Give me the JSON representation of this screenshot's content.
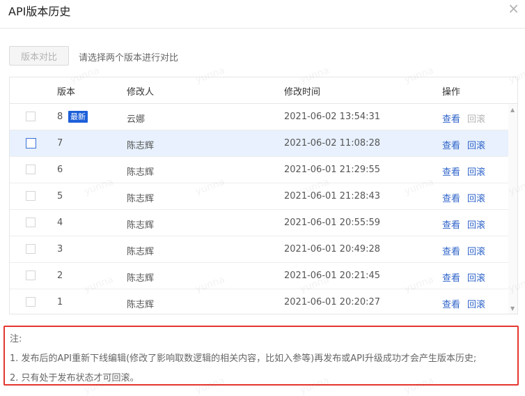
{
  "dialog": {
    "title": "API版本历史",
    "close_glyph": "×"
  },
  "toolbar": {
    "compare_label": "版本对比",
    "hint": "请选择两个版本进行对比"
  },
  "table": {
    "columns": [
      "版本",
      "修改人",
      "修改时间",
      "操作"
    ],
    "latest_badge": "最新",
    "view_label": "查看",
    "rollback_label": "回滚",
    "rows": [
      {
        "version": "8",
        "editor": "云娜",
        "time": "2021-06-02 13:54:31",
        "latest": true,
        "selected": false,
        "rollback_enabled": false
      },
      {
        "version": "7",
        "editor": "陈志辉",
        "time": "2021-06-02 11:08:28",
        "latest": false,
        "selected": true,
        "rollback_enabled": true
      },
      {
        "version": "6",
        "editor": "陈志辉",
        "time": "2021-06-01 21:29:55",
        "latest": false,
        "selected": false,
        "rollback_enabled": true
      },
      {
        "version": "5",
        "editor": "陈志辉",
        "time": "2021-06-01 21:28:43",
        "latest": false,
        "selected": false,
        "rollback_enabled": true
      },
      {
        "version": "4",
        "editor": "陈志辉",
        "time": "2021-06-01 20:55:59",
        "latest": false,
        "selected": false,
        "rollback_enabled": true
      },
      {
        "version": "3",
        "editor": "陈志辉",
        "time": "2021-06-01 20:49:28",
        "latest": false,
        "selected": false,
        "rollback_enabled": true
      },
      {
        "version": "2",
        "editor": "陈志辉",
        "time": "2021-06-01 20:21:45",
        "latest": false,
        "selected": false,
        "rollback_enabled": true
      },
      {
        "version": "1",
        "editor": "陈志辉",
        "time": "2021-06-01 20:20:27",
        "latest": false,
        "selected": false,
        "rollback_enabled": true
      }
    ]
  },
  "notes": {
    "heading": "注:",
    "line1": "1. 发布后的API重新下线编辑(修改了影响取数逻辑的相关内容，比如入参等)再发布或API升级成功才会产生版本历史;",
    "line2": "2. 只有处于发布状态才可回滚。"
  },
  "watermark": {
    "text": "yunna"
  },
  "colors": {
    "link": "#2f64c9",
    "badge": "#1d5fd9",
    "selected_row": "#e8f1fd",
    "notes_border": "#e5362e"
  }
}
